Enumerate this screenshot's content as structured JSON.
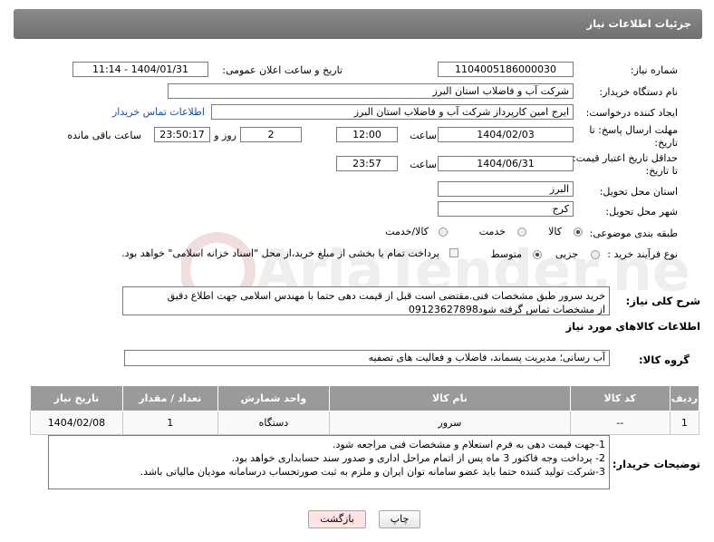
{
  "header": {
    "title": "جزئیات اطلاعات نیاز"
  },
  "form": {
    "need_number_label": "شماره نیاز:",
    "need_number": "1104005186000030",
    "announce_label": "تاریخ و ساعت اعلان عمومی:",
    "announce_value": "1404/01/31 - 11:14",
    "buyer_org_label": "نام دستگاه خریدار:",
    "buyer_org": "شرکت آب و فاضلاب استان البرز",
    "requester_label": "ایجاد کننده درخواست:",
    "requester": "ایرج امین کارپرداز شرکت آب و فاضلاب استان البرز",
    "contact_link": "اطلاعات تماس خریدار",
    "deadline_label_1": "مهلت ارسال پاسخ: تا",
    "deadline_label_2": "تاریخ:",
    "deadline_date": "1404/02/03",
    "time_label": "ساعت",
    "deadline_time": "12:00",
    "days_value": "2",
    "days_label": "روز و",
    "remaining_time": "23:50:17",
    "remaining_label": "ساعت باقی مانده",
    "validity_label_1": "حداقل تاریخ اعتبار قیمت:",
    "validity_label_2": "تا تاریخ:",
    "validity_date": "1404/06/31",
    "validity_time_label": "ساعت",
    "validity_time": "23:57",
    "province_label": "استان محل تحویل:",
    "province": "البرز",
    "city_label": "شهر محل تحویل:",
    "city": "کرج",
    "category_label": "طبقه بندی موضوعی:",
    "category_options": [
      "کالا",
      "خدمت",
      "کالا/خدمت"
    ],
    "process_label": "نوع فرآیند خرید :",
    "process_options": [
      "جزیی",
      "متوسط"
    ],
    "payment_note": "پرداخت تمام یا بخشی از مبلغ خرید،از محل \"اسناد خزانه اسلامی\" خواهد بود."
  },
  "description": {
    "label": "شرح کلی نیاز:",
    "text_line1": "خرید سرور طبق مشخصات فنی.مقتضی است قبل از قیمت دهی حتما با مهندس اسلامی جهت اطلاع دقیق",
    "text_line2": "از مشخصات تماس گرفته شود09123627898"
  },
  "goods": {
    "section_title": "اطلاعات کالاهای مورد نیاز",
    "group_label": "گروه کالا:",
    "group_value": "آب رسانی؛ مدیریت پسماند، فاضلاب و فعالیت های تصفیه",
    "columns": [
      "ردیف",
      "کد کالا",
      "نام کالا",
      "واحد شمارش",
      "تعداد / مقدار",
      "تاریخ نیاز"
    ],
    "rows": [
      [
        "1",
        "--",
        "سرور",
        "دستگاه",
        "1",
        "1404/02/08"
      ]
    ]
  },
  "buyer_notes": {
    "label": "توضیحات خریدار:",
    "line1": "1-جهت قیمت دهی به فرم استعلام و مشخصات فنی مراجعه شود.",
    "line2": "2- پرداخت وجه فاکتور 3 ماه پس از اتمام مراحل اداری و صدور سند حسابداری خواهد بود.",
    "line3": "3-شرکت تولید کننده حتما باید عضو سامانه توان ایران و ملزم به ثبت صورتحساب درسامانه مودیان مالیاتی باشد."
  },
  "buttons": {
    "print": "چاپ",
    "back": "بازگشت"
  },
  "watermark": {
    "text": "AriaTender.neT"
  },
  "colors": {
    "header": "#7a7a7a",
    "link": "#1a4fa0",
    "back_button_bg": "#fde3e3"
  }
}
